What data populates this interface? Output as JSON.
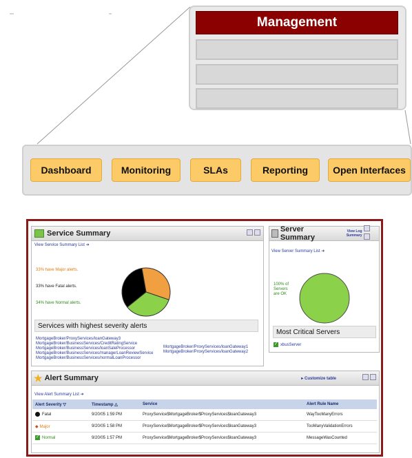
{
  "management": {
    "title": "Management"
  },
  "nav": {
    "items": [
      "Dashboard",
      "Monitoring",
      "SLAs",
      "Reporting",
      "Open Interfaces"
    ]
  },
  "service_summary": {
    "title": "Service Summary",
    "list_link": "View Service Summary List",
    "stats": [
      {
        "text": "33% have Major alerts.",
        "color": "#e07a10"
      },
      {
        "text": "33% have Fatal alerts.",
        "color": "#222222"
      },
      {
        "text": "34% have Normal alerts.",
        "color": "#2f8a1c"
      }
    ],
    "section_title": "Services with highest severity alerts",
    "services_col1": [
      "MortgageBroker/ProxyServices/loanGateway3",
      "MortgageBroker/BusinessServices/CreditRatingService",
      "MortgageBroker/BusinessServices/loanSaleProcessor",
      "MortgageBroker/BusinessServices/managerLoanReviewService",
      "MortgageBroker/BusinessServices/normalLoanProcessor"
    ],
    "services_col2": [
      "MortgageBroker/ProxyServices/loanGateway1",
      "MortgageBroker/ProxyServices/loanGateway2"
    ]
  },
  "server_summary": {
    "title": "Server Summary",
    "view_log": "View Log Summary",
    "list_link": "View Server Summary List",
    "ok_text": "100% of Servers are OK",
    "section_title": "Most Critical Servers",
    "server": "xbusServer"
  },
  "alert_summary": {
    "title": "Alert Summary",
    "customize": "Customize table",
    "list_link": "View Alert Summary List",
    "columns": [
      "Alert Severity",
      "Timestamp",
      "Service",
      "Alert Rule Name"
    ],
    "rows": [
      {
        "severity": "Fatal",
        "timestamp": "9/20/05 1:59 PM",
        "service": "ProxyService$MortgageBroker$ProxyServices$loanGateway3",
        "rule": "WayTooManyErrors"
      },
      {
        "severity": "Major",
        "timestamp": "9/20/05 1:58 PM",
        "service": "ProxyService$MortgageBroker$ProxyServices$loanGateway3",
        "rule": "TooManyValidationErrors"
      },
      {
        "severity": "Normal",
        "timestamp": "9/20/05 1:57 PM",
        "service": "ProxyService$MortgageBroker$ProxyServices$loanGateway3",
        "rule": "MessageWasCounted"
      }
    ]
  },
  "pie": {
    "major": 33,
    "fatal": 33,
    "normal": 34
  },
  "colors": {
    "accent_red": "#8b0000",
    "nav_button": "#fcca66",
    "major": "#f0a040",
    "fatal": "#000000",
    "normal": "#8cd14a"
  }
}
